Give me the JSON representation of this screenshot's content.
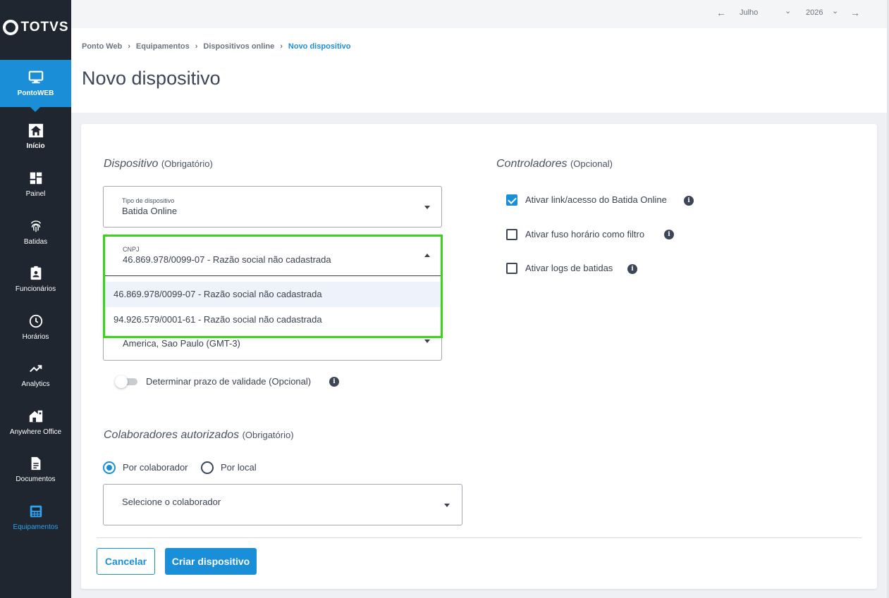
{
  "app": {
    "logo_text": "TOTVS"
  },
  "sidebar": {
    "items": [
      {
        "label": "PontoWEB",
        "icon": "monitor-icon"
      },
      {
        "label": "Início",
        "icon": "home-icon"
      },
      {
        "label": "Painel",
        "icon": "dashboard-icon"
      },
      {
        "label": "Batidas",
        "icon": "fingerprint-icon"
      },
      {
        "label": "Funcionários",
        "icon": "badge-icon"
      },
      {
        "label": "Horários",
        "icon": "clock-icon"
      },
      {
        "label": "Analytics",
        "icon": "trend-icon"
      },
      {
        "label": "Anywhere Office",
        "icon": "home-office-icon"
      },
      {
        "label": "Documentos",
        "icon": "document-icon"
      },
      {
        "label": "Equipamentos",
        "icon": "equipment-icon"
      }
    ]
  },
  "topbar": {
    "month": "Julho",
    "year": "2026"
  },
  "breadcrumb": {
    "items": [
      "Ponto Web",
      "Equipamentos",
      "Dispositivos online"
    ],
    "current": "Novo dispositivo"
  },
  "page": {
    "title": "Novo dispositivo"
  },
  "dispositivo": {
    "title": "Dispositivo",
    "requirement": "(Obrigatório)",
    "tipo": {
      "label": "Tipo de dispositivo",
      "value": "Batida Online"
    },
    "cnpj": {
      "label": "CNPJ",
      "value": "46.869.978/0099-07 - Razão social não cadastrada",
      "options": [
        "46.869.978/0099-07 - Razão social não cadastrada",
        "94.926.579/0001-61 - Razão social não cadastrada"
      ]
    },
    "fuso": {
      "value": "America, Sao Paulo (GMT-3)"
    },
    "validade_label": "Determinar prazo de validade (Opcional)",
    "validade_enabled": false
  },
  "controladores": {
    "title": "Controladores",
    "requirement": "(Opcional)",
    "options": [
      {
        "label": "Ativar link/acesso do Batida Online",
        "checked": true
      },
      {
        "label": "Ativar fuso horário como filtro",
        "checked": false
      },
      {
        "label": "Ativar logs de batidas",
        "checked": false
      }
    ]
  },
  "colaboradores": {
    "title": "Colaboradores autorizados",
    "requirement": "(Obrigatório)",
    "radio_por_colaborador": "Por colaborador",
    "radio_por_local": "Por local",
    "selected": "Por colaborador",
    "select_placeholder": "Selecione o colaborador"
  },
  "actions": {
    "cancel": "Cancelar",
    "create": "Criar dispositivo"
  },
  "colors": {
    "primary": "#1a8fd8",
    "sidebar": "#1f262f",
    "highlight": "#39d418"
  }
}
